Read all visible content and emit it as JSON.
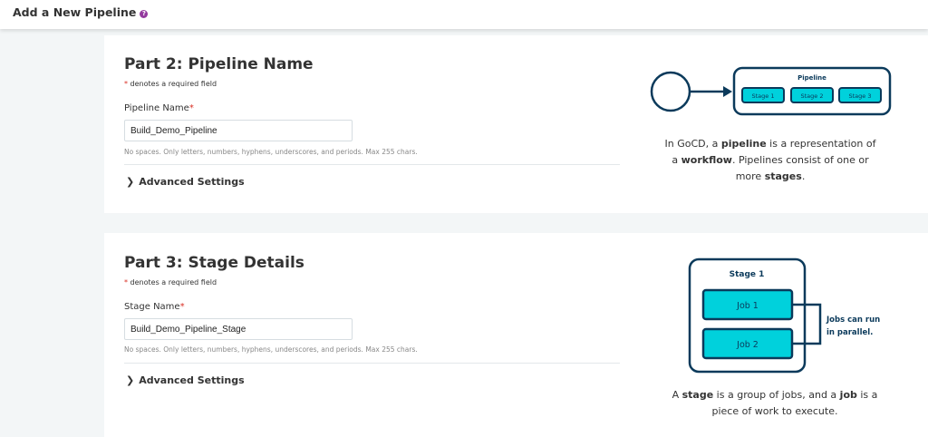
{
  "header": {
    "title": "Add a New Pipeline",
    "help_icon": "?"
  },
  "sections": [
    {
      "title": "Part 2: Pipeline Name",
      "required_note": "denotes a required field",
      "field_label": "Pipeline Name",
      "field_value": "Build_Demo_Pipeline",
      "help_text": "No spaces. Only letters, numbers, hyphens, underscores, and periods. Max 255 chars.",
      "advanced_label": "Advanced Settings"
    },
    {
      "title": "Part 3: Stage Details",
      "required_note": "denotes a required field",
      "field_label": "Stage Name",
      "field_value": "Build_Demo_Pipeline_Stage",
      "help_text": "No spaces. Only letters, numbers, hyphens, underscores, and periods. Max 255 chars.",
      "advanced_label": "Advanced Settings"
    }
  ],
  "pipeline_diagram": {
    "box_label": "Pipeline",
    "stages": [
      "Stage 1",
      "Stage 2",
      "Stage 3"
    ],
    "desc": {
      "p1": "In GoCD, a ",
      "b1": "pipeline",
      "p2": " is a representation of a ",
      "b2": "workflow",
      "p3": ". Pipelines consist of one or more ",
      "b3": "stages",
      "p4": "."
    }
  },
  "stage_diagram": {
    "box_label": "Stage 1",
    "jobs": [
      "Job 1",
      "Job 2"
    ],
    "side_line1": "Jobs can run",
    "side_line2": "in parallel.",
    "desc": {
      "p1": "A ",
      "b1": "stage",
      "p2": " is a group of jobs, and a ",
      "b2": "job",
      "p3": " is a piece of work to execute."
    }
  },
  "colors": {
    "accent": "#943a9e",
    "diagram_dark": "#0b3a5b",
    "diagram_fill": "#00d1dc",
    "required": "#d93025"
  }
}
